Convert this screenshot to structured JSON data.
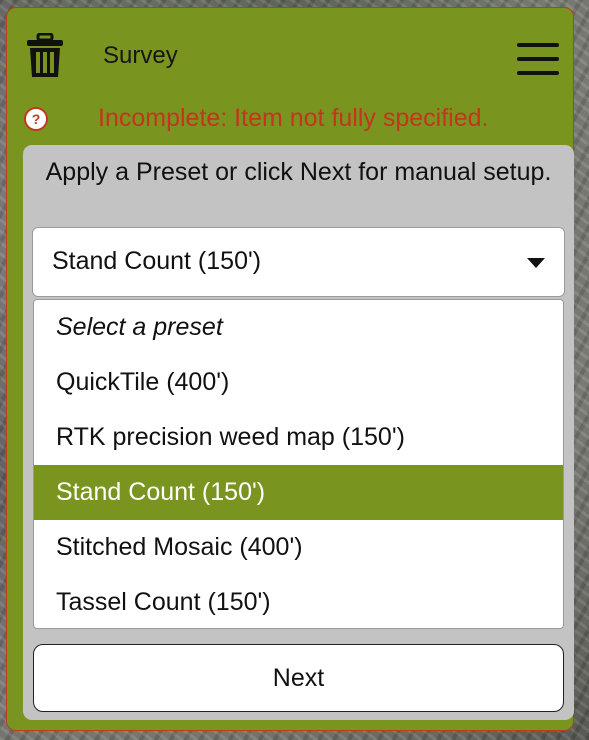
{
  "header": {
    "title": "Survey",
    "left_icon": "trash-icon",
    "right_icon": "menu-icon"
  },
  "status": {
    "icon": "help-icon",
    "icon_glyph": "?",
    "message": "Incomplete: Item not fully specified."
  },
  "preset": {
    "instruction": "Apply a Preset or click Next for manual setup.",
    "selected_value": "Stand Count (150')",
    "placeholder_option": "Select a preset",
    "options": [
      "QuickTile (400')",
      "RTK precision weed map (150')",
      "Stand Count (150')",
      "Stitched Mosaic (400')",
      "Tassel Count (150')"
    ]
  },
  "actions": {
    "next_label": "Next"
  },
  "colors": {
    "panel_green": "#7a9420",
    "status_red": "#c2361d",
    "card_gray": "#c3c3c3",
    "selected_bg": "#7a9420"
  }
}
